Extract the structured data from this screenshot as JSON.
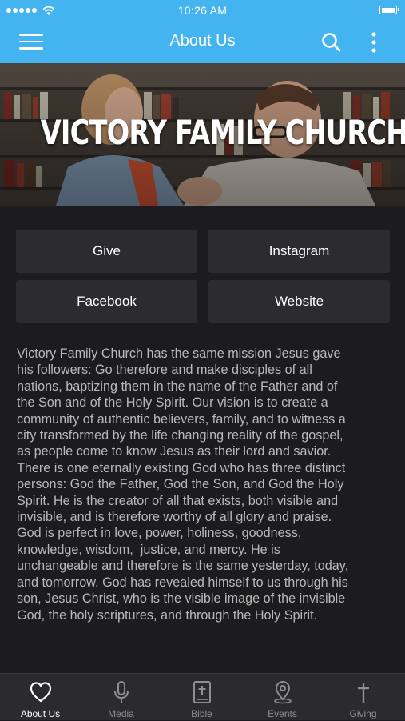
{
  "status_bar": {
    "time": "10:26 AM"
  },
  "nav": {
    "title": "About Us",
    "icons": [
      "menu-icon",
      "search-icon",
      "more-vertical-icon"
    ]
  },
  "hero": {
    "title": "VICTORY FAMILY CHURCH"
  },
  "buttons": [
    {
      "label": "Give"
    },
    {
      "label": "Instagram"
    },
    {
      "label": "Facebook"
    },
    {
      "label": "Website"
    }
  ],
  "description": "Victory Family Church has the same mission Jesus gave\nhis followers: Go therefore and make disciples of all\nnations, baptizing them in the name of the Father and of\nthe Son and of the Holy Spirit. Our vision is to create a\ncommunity of authentic believers, family, and to witness a\ncity transformed by the life changing reality of the gospel,\nas people come to know Jesus as their lord and savior.\nThere is one eternally existing God who has three distinct\npersons: God the Father, God the Son, and God the Holy\nSpirit. He is the creator of all that exists, both visible and\ninvisible, and is therefore worthy of all glory and praise.\nGod is perfect in love, power, holiness, goodness,\nknowledge, wisdom,  justice, and mercy. He is\nunchangeable and therefore is the same yesterday, today,\nand tomorrow. God has revealed himself to us through his\nson, Jesus Christ, who is the visible image of the invisible\nGod, the holy scriptures, and through the Holy Spirit.",
  "tabs": [
    {
      "label": "About Us",
      "icon": "heart-icon",
      "active": true
    },
    {
      "label": "Media",
      "icon": "microphone-icon",
      "active": false
    },
    {
      "label": "Bible",
      "icon": "bible-icon",
      "active": false
    },
    {
      "label": "Events",
      "icon": "location-pin-icon",
      "active": false
    },
    {
      "label": "Giving",
      "icon": "cross-icon",
      "active": false
    }
  ],
  "colors": {
    "accent": "#44b4f0",
    "background": "#1c1c1e",
    "button": "#2c2c2e",
    "tab_bar": "#2b2b2d",
    "text_muted": "#b9b9b9"
  }
}
